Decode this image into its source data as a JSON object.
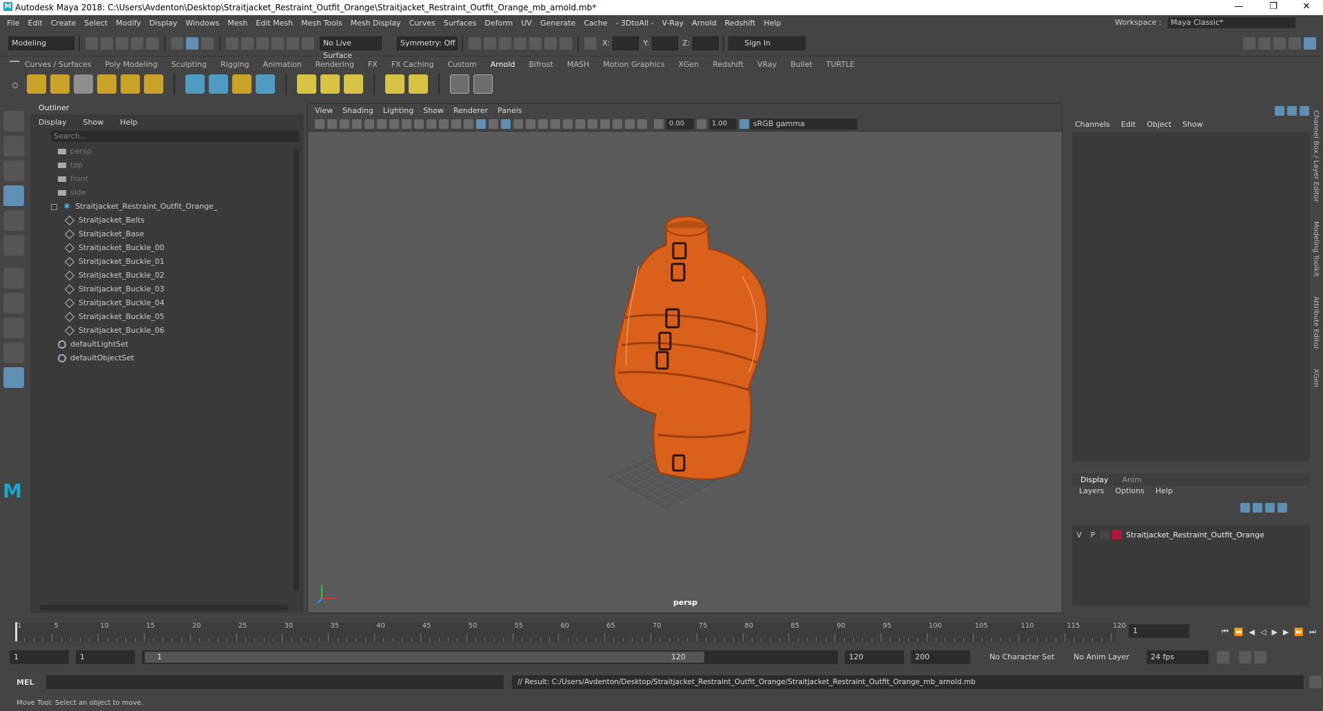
{
  "window": {
    "title": "Autodesk Maya 2018: C:\\Users\\Avdenton\\Desktop\\Straitjacket_Restraint_Outfit_Orange\\Straitjacket_Restraint_Outfit_Orange_mb_arnold.mb*",
    "logo": "M"
  },
  "menubar": [
    "File",
    "Edit",
    "Create",
    "Select",
    "Modify",
    "Display",
    "Windows",
    "Mesh",
    "Edit Mesh",
    "Mesh Tools",
    "Mesh Display",
    "Curves",
    "Surfaces",
    "Deform",
    "UV",
    "Generate",
    "Cache",
    "- 3DtoAll -",
    "V-Ray",
    "Arnold",
    "Redshift",
    "Help"
  ],
  "workspace": {
    "label": "Workspace :",
    "value": "Maya Classic*"
  },
  "statusline": {
    "mode": "Modeling",
    "live_surface": "No Live Surface",
    "symmetry": "Symmetry: Off",
    "x_label": "X:",
    "y_label": "Y:",
    "z_label": "Z:",
    "sign_in": "Sign In"
  },
  "shelf_tabs": [
    "Curves / Surfaces",
    "Poly Modeling",
    "Sculpting",
    "Rigging",
    "Animation",
    "Rendering",
    "FX",
    "FX Caching",
    "Custom",
    "Arnold",
    "Bifrost",
    "MASH",
    "Motion Graphics",
    "XGen",
    "Redshift",
    "VRay",
    "Bullet",
    "TURTLE"
  ],
  "shelf_active": "Arnold",
  "outliner": {
    "title": "Outliner",
    "menu": [
      "Display",
      "Show",
      "Help"
    ],
    "search_placeholder": "Search...",
    "cameras": [
      "persp",
      "top",
      "front",
      "side"
    ],
    "group": "Straitjacket_Restraint_Outfit_Orange_",
    "children": [
      "Straitjacket_Belts",
      "Straitjacket_Base",
      "Straitjacket_Buckle_00",
      "Straitjacket_Buckle_01",
      "Straitjacket_Buckle_02",
      "Straitjacket_Buckle_03",
      "Straitjacket_Buckle_04",
      "Straitjacket_Buckle_05",
      "Straitjacket_Buckle_06"
    ],
    "sets": [
      "defaultLightSet",
      "defaultObjectSet"
    ]
  },
  "viewport": {
    "menu": [
      "View",
      "Shading",
      "Lighting",
      "Show",
      "Renderer",
      "Panels"
    ],
    "exposure": "0.00",
    "gamma": "1.00",
    "colorspace": "sRGB gamma",
    "camera_label": "persp"
  },
  "channelbox": {
    "menu": [
      "Channels",
      "Edit",
      "Object",
      "Show"
    ],
    "tabs": [
      "Display",
      "Anim"
    ],
    "layer_menu": [
      "Layers",
      "Options",
      "Help"
    ],
    "layer": {
      "v": "V",
      "p": "P",
      "name": "Straitjacket_Restraint_Outfit_Orange",
      "color": "#b0173a"
    },
    "side_tabs": [
      "Channel Box / Layer Editor",
      "Modeling Toolkit",
      "Attribute Editor",
      "XGen"
    ]
  },
  "timeline": {
    "ticks": [
      "1",
      "5",
      "10",
      "15",
      "20",
      "25",
      "30",
      "35",
      "40",
      "45",
      "50",
      "55",
      "60",
      "65",
      "70",
      "75",
      "80",
      "85",
      "90",
      "95",
      "100",
      "105",
      "110",
      "115",
      "120"
    ],
    "current_frame": "1"
  },
  "range": {
    "start": "1",
    "inner_start": "1",
    "slider_start": "1",
    "slider_end": "120",
    "end": "120",
    "anim_end": "200",
    "character_set": "No Character Set",
    "anim_layer": "No Anim Layer",
    "fps": "24 fps"
  },
  "mel": {
    "label": "MEL",
    "result": "// Result: C:/Users/Avdenton/Desktop/Straitjacket_Restraint_Outfit_Orange/Straitjacket_Restraint_Outfit_Orange_mb_arnold.mb"
  },
  "helpline": "Move Tool: Select an object to move.",
  "colors": {
    "accent": "#5e8fb2",
    "jacket": "#d9611c",
    "maya": "#1aa7c8"
  }
}
